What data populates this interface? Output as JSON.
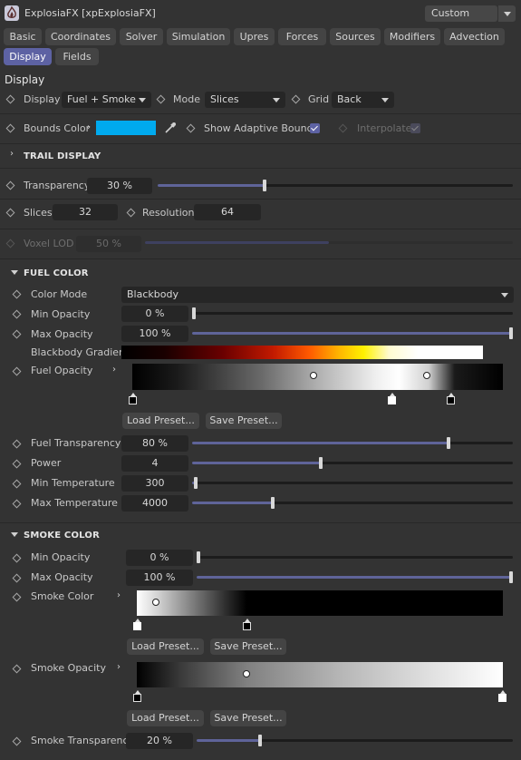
{
  "header": {
    "title": "ExplosiaFX [xpExplosiaFX]",
    "preset": "Custom"
  },
  "tabs_row1": [
    "Basic",
    "Coordinates",
    "Solver",
    "Simulation",
    "Upres",
    "Forces",
    "Sources",
    "Modifiers",
    "Advection"
  ],
  "tabs_row2": [
    "Display",
    "Fields"
  ],
  "active_tab": "Display",
  "display": {
    "heading": "Display",
    "display_label": "Display",
    "display_value": "Fuel + Smoke",
    "mode_label": "Mode",
    "mode_value": "Slices",
    "grid_label": "Grid",
    "grid_value": "Back",
    "bounds_color_label": "Bounds Color",
    "bounds_color": "#00aaee",
    "show_adaptive_label": "Show Adaptive Bounds",
    "show_adaptive_checked": true,
    "interpolate_label": "Interpolate",
    "interpolate_checked": true
  },
  "trail": {
    "label": "TRAIL DISPLAY"
  },
  "view": {
    "transparency_label": "Transparency",
    "transparency_value": "30 %",
    "transparency_level": 0.3,
    "slices_label": "Slices",
    "slices_value": "32",
    "resolution_label": "Resolution",
    "resolution_value": "64",
    "voxel_lod_label": "Voxel LOD",
    "voxel_lod_value": "50 %",
    "voxel_lod_level": 0.5
  },
  "fuel": {
    "section_label": "FUEL COLOR",
    "color_mode_label": "Color Mode",
    "color_mode_value": "Blackbody",
    "min_opacity_label": "Min Opacity",
    "min_opacity_value": "0 %",
    "min_opacity_level": 0.0,
    "max_opacity_label": "Max Opacity",
    "max_opacity_value": "100 %",
    "max_opacity_level": 1.0,
    "blackbody_label": "Blackbody Gradient",
    "fuel_opacity_label": "Fuel Opacity",
    "load_preset": "Load Preset...",
    "save_preset": "Save Preset...",
    "fuel_transparency_label": "Fuel Transparency",
    "fuel_transparency_value": "80 %",
    "fuel_transparency_level": 0.8,
    "power_label": "Power",
    "power_value": "4",
    "power_level": 0.4,
    "min_temp_label": "Min Temperature",
    "min_temp_value": "300",
    "min_temp_level": 0.01,
    "max_temp_label": "Max Temperature",
    "max_temp_value": "4000",
    "max_temp_level": 0.25
  },
  "smoke": {
    "section_label": "SMOKE COLOR",
    "min_opacity_label": "Min Opacity",
    "min_opacity_value": "0 %",
    "min_opacity_level": 0.0,
    "max_opacity_label": "Max Opacity",
    "max_opacity_value": "100 %",
    "max_opacity_level": 1.0,
    "smoke_color_label": "Smoke Color",
    "smoke_opacity_label": "Smoke Opacity",
    "load_preset": "Load Preset...",
    "save_preset": "Save Preset...",
    "smoke_transparency_label": "Smoke Transparency",
    "smoke_transparency_value": "20 %",
    "smoke_transparency_level": 0.2
  }
}
